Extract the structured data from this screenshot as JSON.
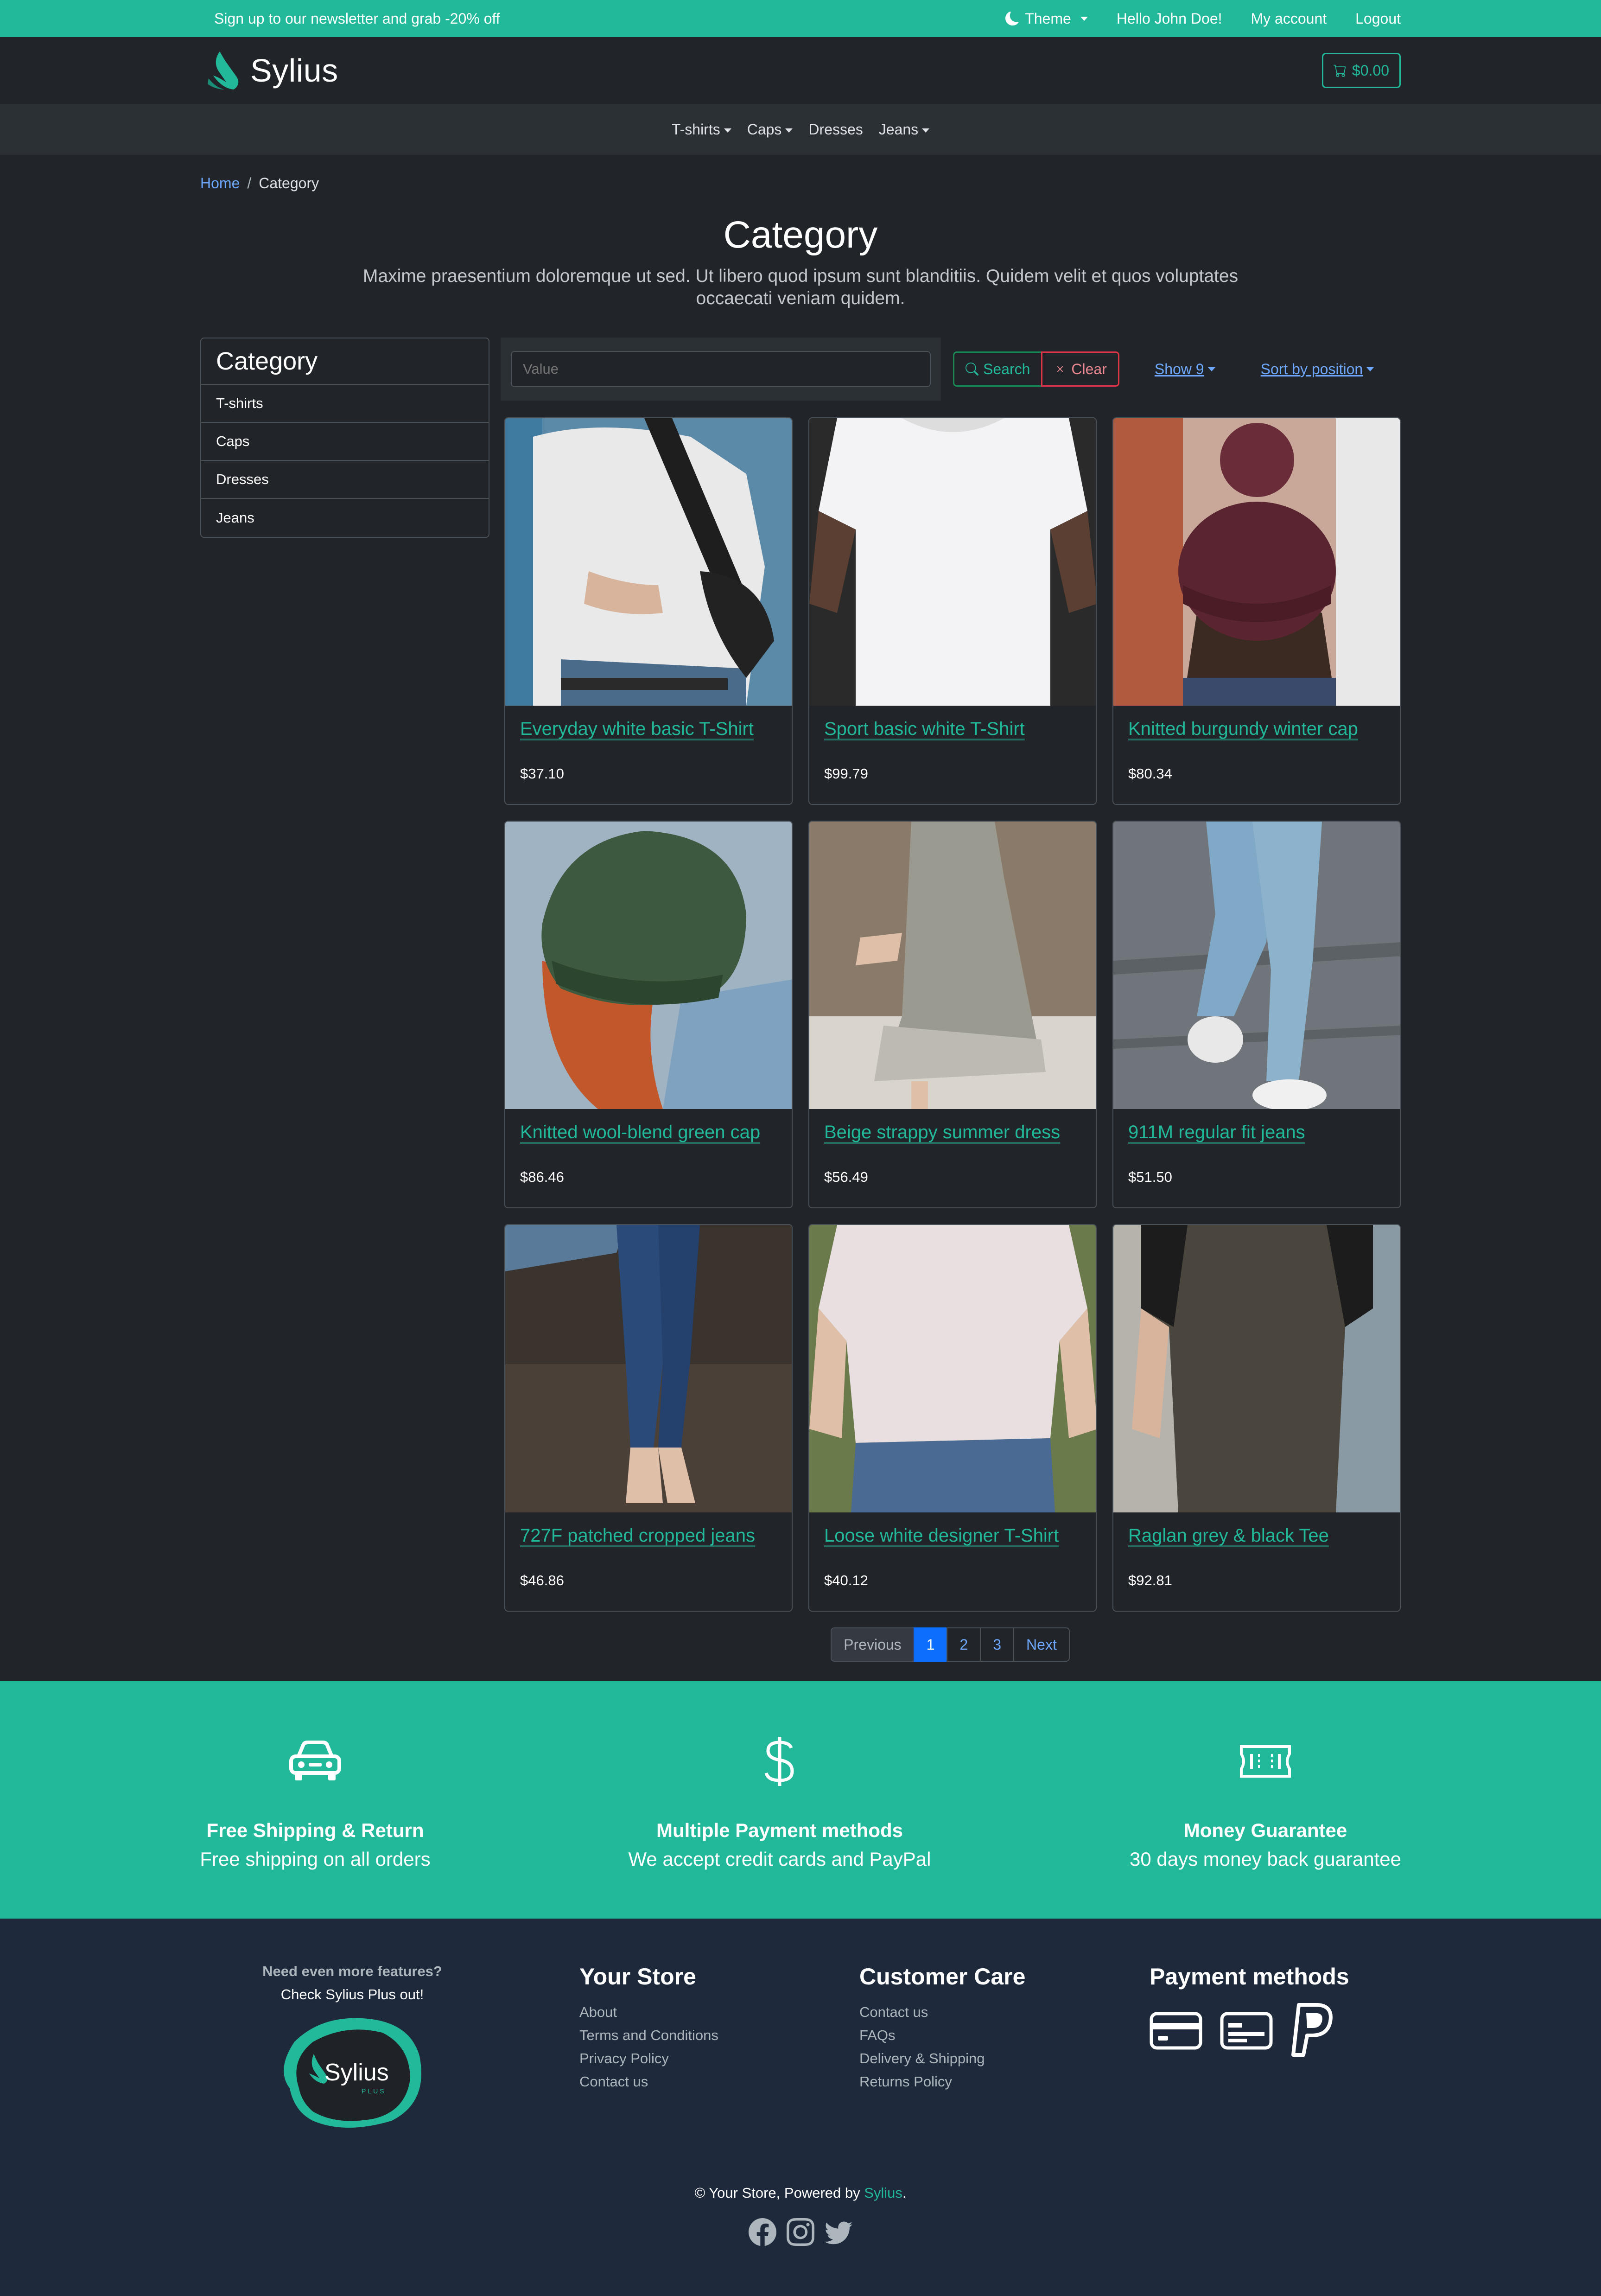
{
  "topbar": {
    "promo": "Sign up to our newsletter and grab -20% off",
    "theme_label": "Theme",
    "greeting": "Hello John Doe!",
    "my_account": "My account",
    "logout": "Logout"
  },
  "header": {
    "logo_text": "Sylius",
    "cart_total": "$0.00"
  },
  "nav": {
    "items": [
      {
        "label": "T-shirts",
        "dropdown": true
      },
      {
        "label": "Caps",
        "dropdown": true
      },
      {
        "label": "Dresses",
        "dropdown": false
      },
      {
        "label": "Jeans",
        "dropdown": true
      }
    ]
  },
  "breadcrumb": {
    "home": "Home",
    "separator": "/",
    "current": "Category"
  },
  "page": {
    "title": "Category",
    "description": "Maxime praesentium doloremque ut sed. Ut libero quod ipsum sunt blanditiis. Quidem velit et quos voluptates occaecati veniam quidem."
  },
  "sidebar": {
    "title": "Category",
    "items": [
      {
        "label": "T-shirts"
      },
      {
        "label": "Caps"
      },
      {
        "label": "Dresses"
      },
      {
        "label": "Jeans"
      }
    ]
  },
  "filter": {
    "placeholder": "Value",
    "search_label": "Search",
    "clear_label": "Clear",
    "show_label": "Show 9",
    "sort_label": "Sort by position"
  },
  "products": [
    {
      "name": "Everyday white basic T-Shirt",
      "price": "$37.10"
    },
    {
      "name": "Sport basic white T-Shirt",
      "price": "$99.79"
    },
    {
      "name": "Knitted burgundy winter cap",
      "price": "$80.34"
    },
    {
      "name": "Knitted wool-blend green cap",
      "price": "$86.46"
    },
    {
      "name": "Beige strappy summer dress",
      "price": "$56.49"
    },
    {
      "name": "911M regular fit jeans",
      "price": "$51.50"
    },
    {
      "name": "727F patched cropped jeans",
      "price": "$46.86"
    },
    {
      "name": "Loose white designer T-Shirt",
      "price": "$40.12"
    },
    {
      "name": "Raglan grey & black Tee",
      "price": "$92.81"
    }
  ],
  "pagination": {
    "previous": "Previous",
    "pages": [
      "1",
      "2",
      "3"
    ],
    "active_page": "1",
    "next": "Next"
  },
  "features": [
    {
      "icon": "car-icon",
      "title": "Free Shipping & Return",
      "desc": "Free shipping on all orders"
    },
    {
      "icon": "dollar-icon",
      "title": "Multiple Payment methods",
      "desc": "We accept credit cards and PayPal"
    },
    {
      "icon": "cash-icon",
      "title": "Money Guarantee",
      "desc": "30 days money back guarantee"
    }
  ],
  "footer": {
    "promo_question": "Need even more features?",
    "promo_cta": "Check Sylius Plus out!",
    "promo_logo_text": "Sylius",
    "promo_logo_sub": "PLUS",
    "your_store": {
      "title": "Your Store",
      "links": [
        "About",
        "Terms and Conditions",
        "Privacy Policy",
        "Contact us"
      ]
    },
    "customer_care": {
      "title": "Customer Care",
      "links": [
        "Contact us",
        "FAQs",
        "Delivery & Shipping",
        "Returns Policy"
      ]
    },
    "payment": {
      "title": "Payment methods",
      "icons": [
        "credit-card-icon",
        "card-icon",
        "paypal-icon"
      ]
    },
    "copyright_prefix": "© Your Store, Powered by",
    "copyright_brand": "Sylius",
    "copyright_suffix": ".",
    "social": [
      "facebook-icon",
      "instagram-icon",
      "twitter-icon"
    ]
  },
  "colors": {
    "brand": "#22b99a",
    "background": "#212529",
    "footer": "#1e293b",
    "link": "#6ea8fe",
    "active_page": "#0d6efd"
  }
}
